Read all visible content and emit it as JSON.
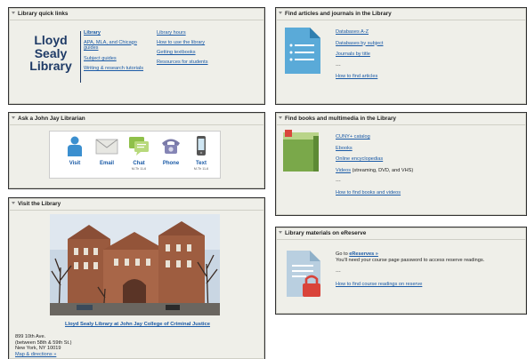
{
  "quick_links": {
    "title": "Library quick links",
    "logo_lines": [
      "Lloyd",
      "Sealy",
      "Library"
    ],
    "col1": [
      "Library",
      "APA, MLA, and Chicago guides",
      "Subject guides",
      "Writing & research tutorials"
    ],
    "col2": [
      "Library hours",
      "How to use the library",
      "Getting textbooks",
      "Resources for students"
    ]
  },
  "ask": {
    "title": "Ask a John Jay Librarian",
    "items": [
      {
        "label": "Visit",
        "sub": "",
        "icon": "person-icon"
      },
      {
        "label": "Email",
        "sub": "",
        "icon": "envelope-icon"
      },
      {
        "label": "Chat",
        "sub": "M-Th 11-6",
        "icon": "chat-icon"
      },
      {
        "label": "Phone",
        "sub": "",
        "icon": "phone-icon"
      },
      {
        "label": "Text",
        "sub": "M-Th 11-6",
        "icon": "mobile-icon"
      }
    ]
  },
  "visit": {
    "title": "Visit the Library",
    "caption": "Lloyd Sealy Library at John Jay College of Criminal Justice",
    "address": [
      "899 10th Ave.",
      "(between 58th & 59th St.)",
      "New York, NY 10019"
    ],
    "map_link": "Map & directions »"
  },
  "articles": {
    "title": "Find articles and journals in the Library",
    "links": [
      "Databases A-Z",
      "Databases by subject",
      "Journals by title"
    ],
    "sep": "---",
    "howto": "How to find articles"
  },
  "books": {
    "title": "Find books and multimedia in the Library",
    "links": [
      "CUNY+ catalog",
      "Ebooks",
      "Online encyclopedias"
    ],
    "videos_link": "Videos",
    "videos_rest": " (streaming, DVD, and VHS)",
    "sep": "---",
    "howto": "How to find books and videos"
  },
  "ereserve": {
    "title": "Library materials on eReserve",
    "goto_prefix": "Go to ",
    "goto_link": "eReserves »",
    "note": "You'll need your course page password to access reserve readings.",
    "sep": "---",
    "howto": "How to find course readings on reserve"
  },
  "colors": {
    "link": "#1a5aa6",
    "panel_bg": "#efefe9",
    "logo": "#1e3a66"
  }
}
